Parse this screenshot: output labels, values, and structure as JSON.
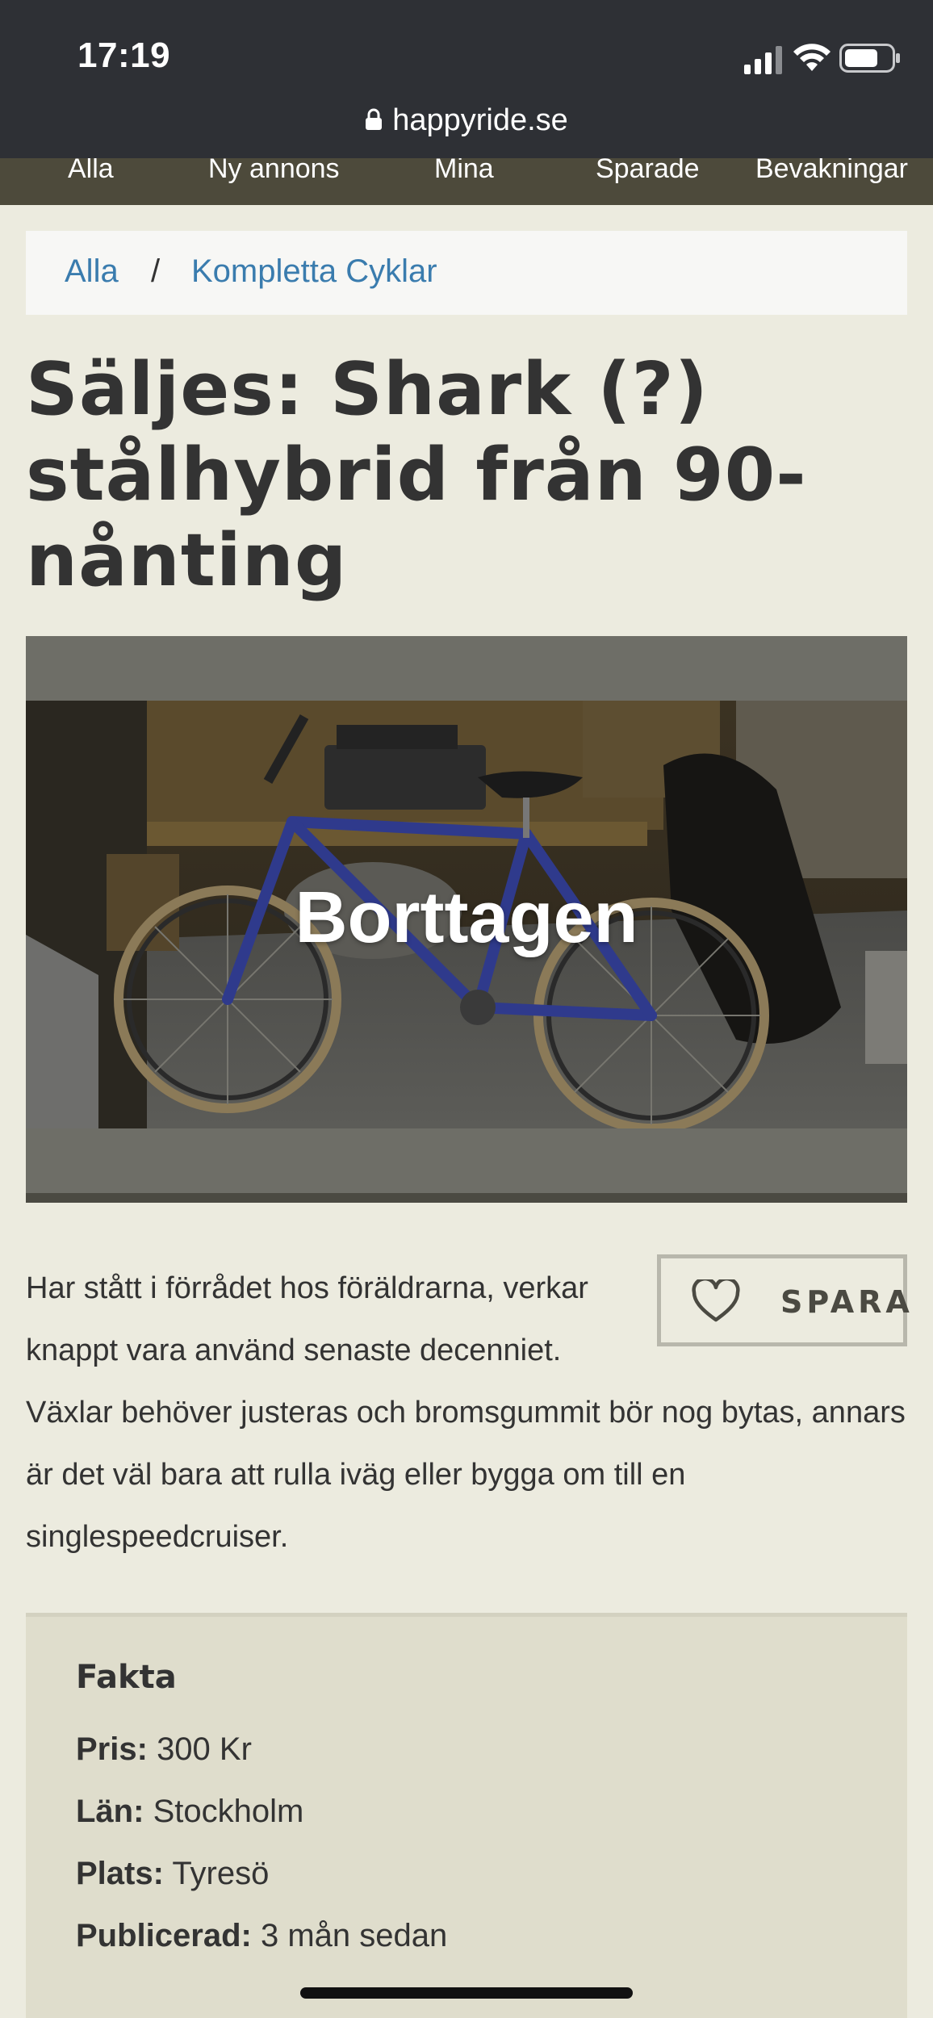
{
  "status_bar": {
    "time": "17:19",
    "url": "happyride.se"
  },
  "nav": {
    "items": [
      {
        "label": "Alla"
      },
      {
        "label": "Ny annons"
      },
      {
        "label": "Mina"
      },
      {
        "label": "Sparade"
      },
      {
        "label": "Bevakningar"
      }
    ]
  },
  "breadcrumb": {
    "home": "Alla",
    "separator": "/",
    "category": "Kompletta Cyklar"
  },
  "title": "Säljes: Shark (?) stålhybrid från 90-nånting",
  "image": {
    "overlay_text": "Borttagen"
  },
  "save": {
    "label": "SPARA",
    "icon": "heart-outline-icon"
  },
  "description": "Har stått i förrådet hos föräldrarna, verkar knappt vara använd senaste decenniet. Växlar behöver justeras och bromsgummit bör nog bytas, annars är det väl bara att rulla iväg eller bygga om till en singlespeedcruiser.",
  "facts": {
    "title": "Fakta",
    "rows": [
      {
        "label": "Pris:",
        "value": "300 Kr"
      },
      {
        "label": "Län:",
        "value": "Stockholm"
      },
      {
        "label": "Plats:",
        "value": "Tyresö"
      },
      {
        "label": "Publicerad:",
        "value": "3 mån sedan"
      }
    ]
  },
  "colors": {
    "background": "#ecebdf",
    "nav_bg": "#4d4a3b",
    "link": "#3a7cae",
    "facts_bg": "#dfddcc"
  }
}
